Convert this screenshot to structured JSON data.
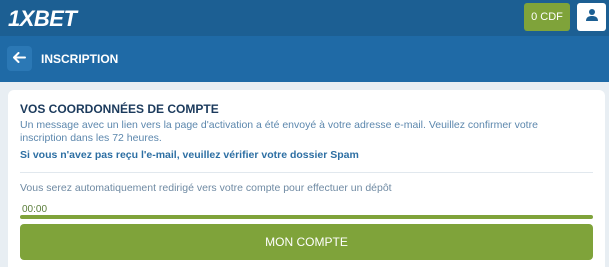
{
  "header": {
    "logo_text": "1XBET",
    "balance_label": "0 CDF",
    "user_icon": "user-icon"
  },
  "subheader": {
    "back_icon": "arrow-left-icon",
    "title": "INSCRIPTION"
  },
  "card": {
    "title": "VOS COORDONNÉES DE COMPTE",
    "message": "Un message avec un lien vers la page d'activation a été envoyé à votre adresse e-mail. Veuillez confirmer votre inscription dans les 72 heures.",
    "spam_notice": "Si vous n'avez pas reçu l'e-mail, veuillez vérifier votre dossier Spam",
    "redirect_notice": "Vous serez automatiquement redirigé vers votre compte pour effectuer un dépôt",
    "timer": "00:00",
    "progress": 1.0,
    "button_label": "MON COMPTE"
  },
  "colors": {
    "topbar": "#1c5f93",
    "subbar": "#1f6aa6",
    "accent_green": "#7fa33a",
    "title_dark": "#1b3a5c",
    "text_blue": "#5c87ad"
  }
}
